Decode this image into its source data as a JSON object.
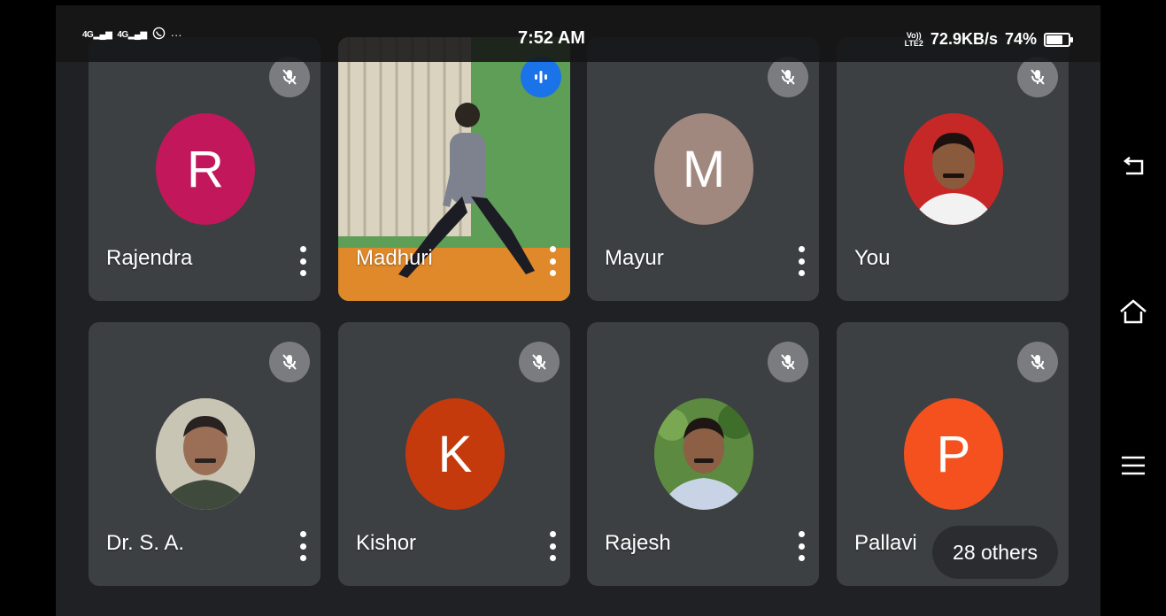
{
  "status_bar": {
    "signal_1": "4G",
    "signal_2": "4G",
    "more": "···",
    "time": "7:52 AM",
    "volte_top": "Vo))",
    "volte_bottom": "LTE2",
    "speed": "72.9KB/s",
    "battery": "74%",
    "battery_level": 0.74
  },
  "colors": {
    "tile_bg": "#3c4043",
    "screen_bg": "#202124",
    "avatar_rajendra": "#c2185b",
    "avatar_mayur": "#a1887f",
    "avatar_kishor": "#c53a0c",
    "avatar_pallavi": "#f4511e",
    "speaking": "#1a73e8"
  },
  "participants": [
    {
      "name": "Rajendra",
      "initial": "R",
      "muted": true
    },
    {
      "name": "Madhuri",
      "initial": "",
      "muted": false,
      "speaking": true
    },
    {
      "name": "Mayur",
      "initial": "M",
      "muted": true
    },
    {
      "name": "You",
      "initial": "",
      "muted": true
    },
    {
      "name": "Dr. S. A.",
      "initial": "",
      "muted": true
    },
    {
      "name": "Kishor",
      "initial": "K",
      "muted": true
    },
    {
      "name": "Rajesh",
      "initial": "",
      "muted": true
    },
    {
      "name": "Pallavi",
      "initial": "P",
      "muted": true
    }
  ],
  "others_label": "28 others",
  "navbar": {
    "icons": [
      "back-icon",
      "home-icon",
      "menu-icon"
    ]
  }
}
